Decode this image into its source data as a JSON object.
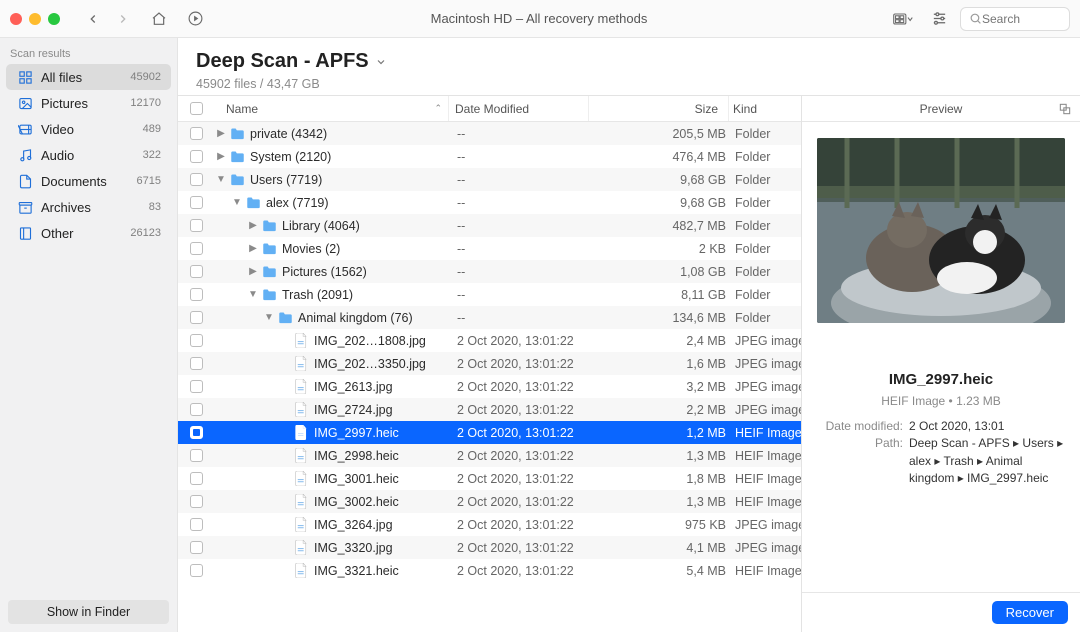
{
  "window_title": "Macintosh HD – All recovery methods",
  "search_placeholder": "Search",
  "sidebar": {
    "header": "Scan results",
    "items": [
      {
        "icon": "grid",
        "label": "All files",
        "count": "45902",
        "selected": true
      },
      {
        "icon": "picture",
        "label": "Pictures",
        "count": "12170"
      },
      {
        "icon": "video",
        "label": "Video",
        "count": "489"
      },
      {
        "icon": "audio",
        "label": "Audio",
        "count": "322"
      },
      {
        "icon": "doc",
        "label": "Documents",
        "count": "6715"
      },
      {
        "icon": "archive",
        "label": "Archives",
        "count": "83"
      },
      {
        "icon": "other",
        "label": "Other",
        "count": "26123"
      }
    ],
    "show_in_finder": "Show in Finder"
  },
  "header": {
    "title": "Deep Scan - APFS",
    "subtitle": "45902 files / 43,47 GB"
  },
  "columns": {
    "name": "Name",
    "date": "Date Modified",
    "size": "Size",
    "kind": "Kind"
  },
  "preview": {
    "title": "Preview",
    "filename": "IMG_2997.heic",
    "meta_line": "HEIF Image  •  1.23 MB",
    "date_label": "Date modified:",
    "date_value": "2 Oct 2020, 13:01",
    "path_label": "Path:",
    "path_value": "Deep Scan - APFS ▸ Users ▸ alex ▸ Trash ▸ Animal kingdom ▸ IMG_2997.heic"
  },
  "recover_label": "Recover",
  "rows": [
    {
      "indent": 0,
      "expander": "closed",
      "icon": "folder",
      "name": "private (4342)",
      "date": "--",
      "size": "205,5 MB",
      "kind": "Folder"
    },
    {
      "indent": 0,
      "expander": "closed",
      "icon": "folder",
      "name": "System (2120)",
      "date": "--",
      "size": "476,4 MB",
      "kind": "Folder"
    },
    {
      "indent": 0,
      "expander": "open",
      "icon": "folder",
      "name": "Users (7719)",
      "date": "--",
      "size": "9,68 GB",
      "kind": "Folder"
    },
    {
      "indent": 1,
      "expander": "open",
      "icon": "folder",
      "name": "alex (7719)",
      "date": "--",
      "size": "9,68 GB",
      "kind": "Folder"
    },
    {
      "indent": 2,
      "expander": "closed",
      "icon": "folder",
      "name": "Library (4064)",
      "date": "--",
      "size": "482,7 MB",
      "kind": "Folder"
    },
    {
      "indent": 2,
      "expander": "closed",
      "icon": "folder",
      "name": "Movies (2)",
      "date": "--",
      "size": "2 KB",
      "kind": "Folder"
    },
    {
      "indent": 2,
      "expander": "closed",
      "icon": "folder",
      "name": "Pictures (1562)",
      "date": "--",
      "size": "1,08 GB",
      "kind": "Folder"
    },
    {
      "indent": 2,
      "expander": "open",
      "icon": "folder",
      "name": "Trash (2091)",
      "date": "--",
      "size": "8,11 GB",
      "kind": "Folder"
    },
    {
      "indent": 3,
      "expander": "open",
      "icon": "folder",
      "name": "Animal kingdom (76)",
      "date": "--",
      "size": "134,6 MB",
      "kind": "Folder"
    },
    {
      "indent": 4,
      "expander": "none",
      "icon": "file",
      "name": "IMG_202…1808.jpg",
      "date": "2 Oct 2020, 13:01:22",
      "size": "2,4 MB",
      "kind": "JPEG image"
    },
    {
      "indent": 4,
      "expander": "none",
      "icon": "file",
      "name": "IMG_202…3350.jpg",
      "date": "2 Oct 2020, 13:01:22",
      "size": "1,6 MB",
      "kind": "JPEG image"
    },
    {
      "indent": 4,
      "expander": "none",
      "icon": "file",
      "name": "IMG_2613.jpg",
      "date": "2 Oct 2020, 13:01:22",
      "size": "3,2 MB",
      "kind": "JPEG image"
    },
    {
      "indent": 4,
      "expander": "none",
      "icon": "file",
      "name": "IMG_2724.jpg",
      "date": "2 Oct 2020, 13:01:22",
      "size": "2,2 MB",
      "kind": "JPEG image"
    },
    {
      "indent": 4,
      "expander": "none",
      "icon": "file",
      "name": "IMG_2997.heic",
      "date": "2 Oct 2020, 13:01:22",
      "size": "1,2 MB",
      "kind": "HEIF Image",
      "selected": true,
      "checked": true
    },
    {
      "indent": 4,
      "expander": "none",
      "icon": "file",
      "name": "IMG_2998.heic",
      "date": "2 Oct 2020, 13:01:22",
      "size": "1,3 MB",
      "kind": "HEIF Image"
    },
    {
      "indent": 4,
      "expander": "none",
      "icon": "file",
      "name": "IMG_3001.heic",
      "date": "2 Oct 2020, 13:01:22",
      "size": "1,8 MB",
      "kind": "HEIF Image"
    },
    {
      "indent": 4,
      "expander": "none",
      "icon": "file",
      "name": "IMG_3002.heic",
      "date": "2 Oct 2020, 13:01:22",
      "size": "1,3 MB",
      "kind": "HEIF Image"
    },
    {
      "indent": 4,
      "expander": "none",
      "icon": "file",
      "name": "IMG_3264.jpg",
      "date": "2 Oct 2020, 13:01:22",
      "size": "975 KB",
      "kind": "JPEG image"
    },
    {
      "indent": 4,
      "expander": "none",
      "icon": "file",
      "name": "IMG_3320.jpg",
      "date": "2 Oct 2020, 13:01:22",
      "size": "4,1 MB",
      "kind": "JPEG image"
    },
    {
      "indent": 4,
      "expander": "none",
      "icon": "file",
      "name": "IMG_3321.heic",
      "date": "2 Oct 2020, 13:01:22",
      "size": "5,4 MB",
      "kind": "HEIF Image"
    }
  ]
}
